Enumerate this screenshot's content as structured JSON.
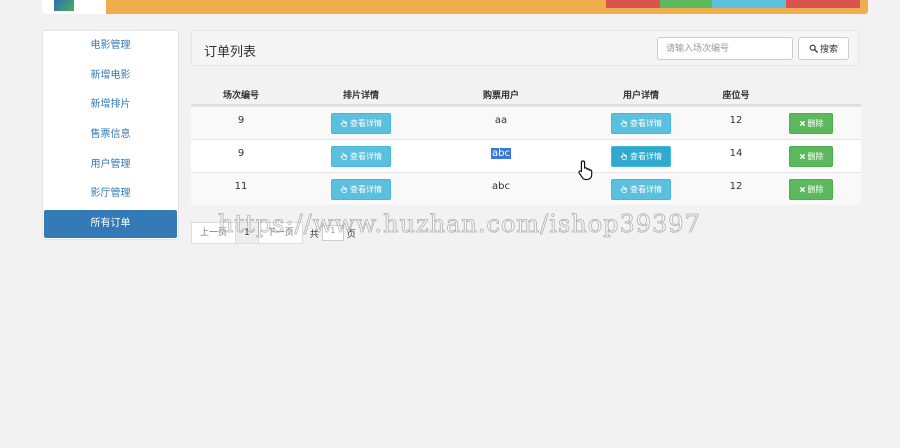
{
  "sidebar": {
    "items": [
      {
        "label": "电影管理"
      },
      {
        "label": "新增电影"
      },
      {
        "label": "新增排片"
      },
      {
        "label": "售票信息"
      },
      {
        "label": "用户管理"
      },
      {
        "label": "影厅管理"
      },
      {
        "label": "所有订单",
        "active": true
      }
    ]
  },
  "panel": {
    "title": "订单列表",
    "search_placeholder": "请输入场次编号",
    "search_value": "",
    "search_button": "搜索"
  },
  "table": {
    "columns": [
      "场次编号",
      "排片详情",
      "购票用户",
      "用户详情",
      "座位号",
      ""
    ],
    "view_label": "查看详情",
    "delete_label": "删除",
    "rows": [
      {
        "session": "9",
        "user": "aa",
        "seat": "12"
      },
      {
        "session": "9",
        "user": "abc",
        "seat": "14"
      },
      {
        "session": "11",
        "user": "abc",
        "seat": "12"
      }
    ]
  },
  "pager": {
    "prev": "上一页",
    "current": "1",
    "next": "下一页",
    "total_prefix": "共",
    "total_value": "1",
    "total_suffix": "页"
  },
  "watermark": "https://www.huzhan.com/ishop39397",
  "colors": {
    "primary": "#337ab7",
    "info": "#5bc0de",
    "success": "#5cb85c",
    "warning": "#f0ad4e",
    "danger": "#d9534f"
  }
}
